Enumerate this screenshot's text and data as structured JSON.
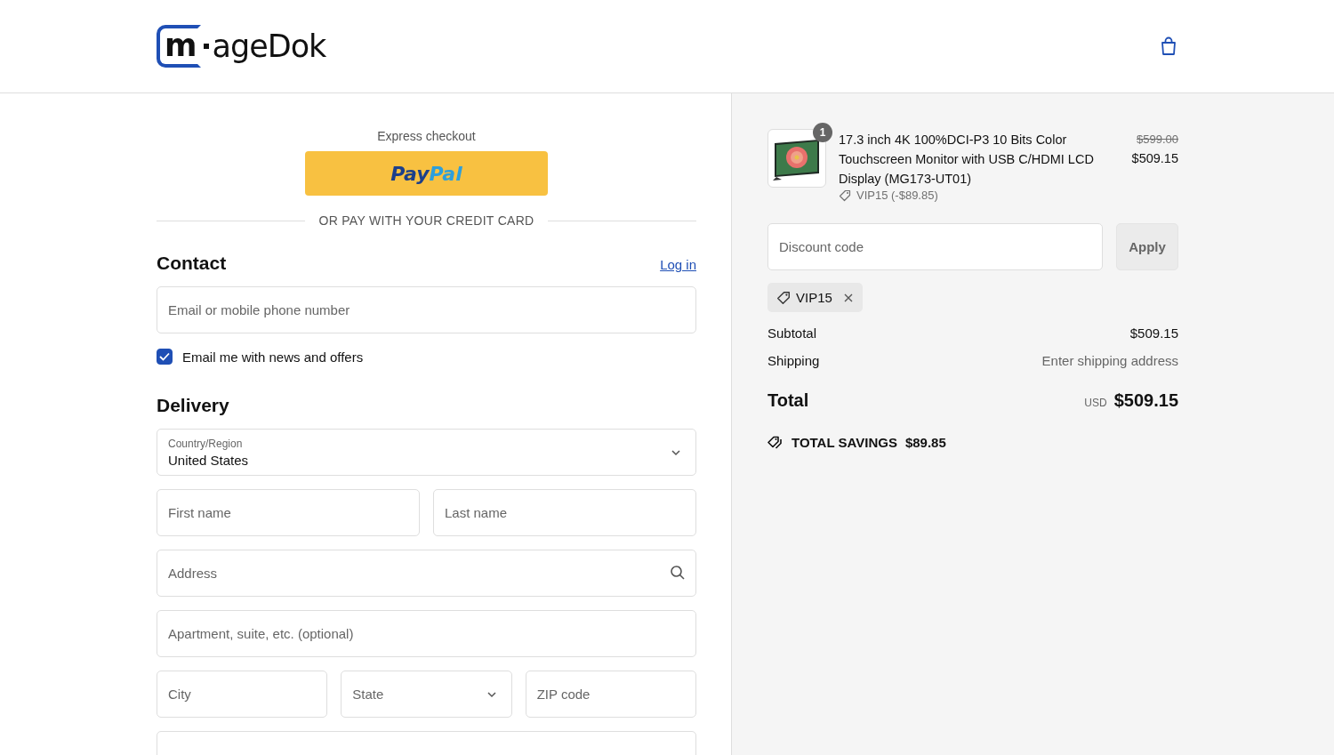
{
  "header": {
    "logo_mark": "m",
    "logo_text": "ageDok"
  },
  "express": {
    "title": "Express checkout",
    "paypal": {
      "pay": "Pay",
      "pal": "Pal"
    },
    "divider": "OR PAY WITH YOUR CREDIT CARD"
  },
  "contact": {
    "heading": "Contact",
    "login": "Log in",
    "email_placeholder": "Email or mobile phone number",
    "newsletter": {
      "label": "Email me with news and offers",
      "checked": true
    }
  },
  "delivery": {
    "heading": "Delivery",
    "country": {
      "label": "Country/Region",
      "value": "United States"
    },
    "rows": [
      [
        {
          "kind": "text",
          "placeholder": "First name"
        },
        {
          "kind": "text",
          "placeholder": "Last name"
        }
      ],
      [
        {
          "kind": "search",
          "placeholder": "Address"
        }
      ],
      [
        {
          "kind": "text",
          "placeholder": "Apartment, suite, etc. (optional)"
        }
      ],
      [
        {
          "kind": "text",
          "placeholder": "City"
        },
        {
          "kind": "select",
          "placeholder": "State"
        },
        {
          "kind": "text",
          "placeholder": "ZIP code"
        }
      ],
      [
        {
          "kind": "text"
        }
      ]
    ]
  },
  "summary": {
    "items": [
      {
        "quantity": "1",
        "name": "17.3 inch 4K 100%DCI-P3 10 Bits Color Touchscreen Monitor with USB C/HDMI LCD Display (MG173-UT01)",
        "discount": "VIP15 (-$89.85)",
        "original_price": "$599.00",
        "price": "$509.15"
      }
    ],
    "discount_placeholder": "Discount code",
    "apply": "Apply",
    "applied_code": "VIP15",
    "lines": [
      {
        "label": "Subtotal",
        "value": "$509.15",
        "muted": false
      },
      {
        "label": "Shipping",
        "value": "Enter shipping address",
        "muted": true
      }
    ],
    "total": {
      "label": "Total",
      "currency": "USD",
      "value": "$509.15"
    },
    "savings": {
      "label": "TOTAL SAVINGS",
      "value": "$89.85"
    }
  }
}
